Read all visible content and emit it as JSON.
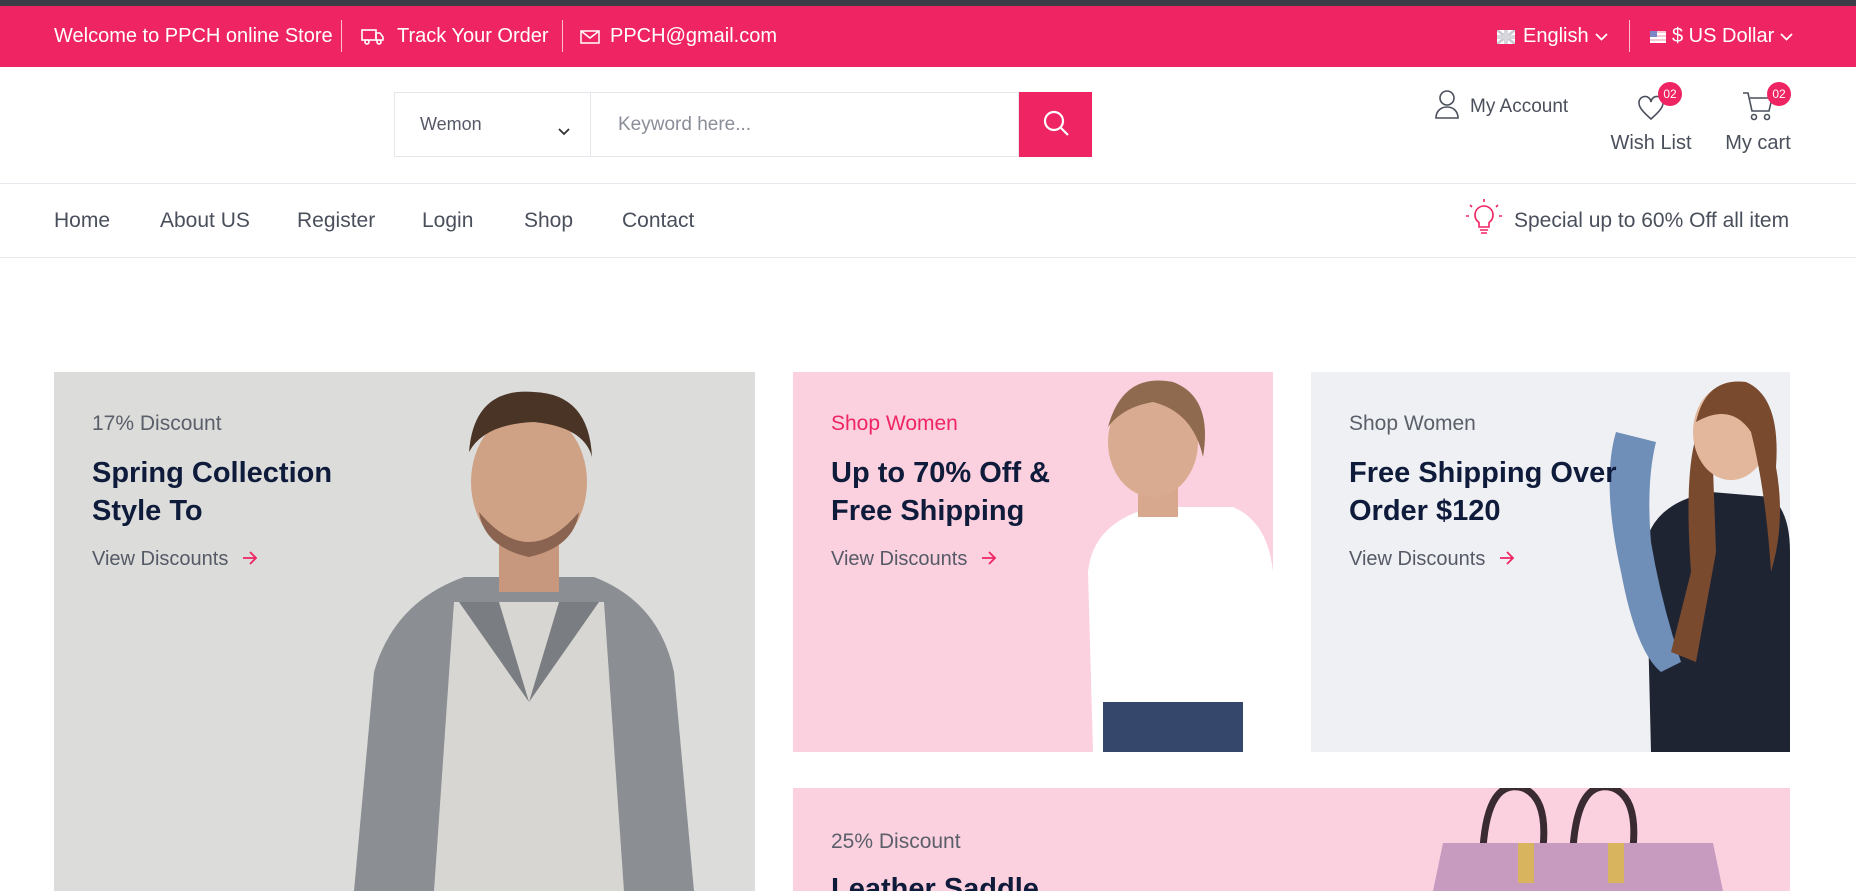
{
  "topbar": {
    "welcome": "Welcome to PPCH online Store",
    "track_order": "Track Your Order",
    "email": "PPCH@gmail.com",
    "language": "English",
    "currency": "$ US Dollar",
    "icons": [
      "truck-icon",
      "mail-icon",
      "uk-flag-icon",
      "us-flag-icon",
      "chevron-down-icon"
    ]
  },
  "header": {
    "category_selected": "Wemon",
    "search_placeholder": "Keyword here...",
    "account_label": "My Account",
    "wishlist_label": "Wish List",
    "wishlist_count": "02",
    "cart_label": "My cart",
    "cart_count": "02",
    "icons": [
      "search-icon",
      "user-icon",
      "heart-icon",
      "cart-icon"
    ]
  },
  "nav": {
    "items": [
      "Home",
      "About US",
      "Register",
      "Login",
      "Shop",
      "Contact"
    ],
    "promo_text": "Special up to 60% Off all item",
    "promo_icon": "lightbulb-icon"
  },
  "banners": [
    {
      "eyebrow": "17% Discount",
      "title_line1": "Spring Collection",
      "title_line2": "Style To",
      "cta": "View Discounts"
    },
    {
      "eyebrow": "Shop Women",
      "title_line1": "Up to 70% Off &",
      "title_line2": "Free Shipping",
      "cta": "View Discounts"
    },
    {
      "eyebrow": "Shop Women",
      "title_line1": "Free Shipping Over",
      "title_line2": "Order $120",
      "cta": "View Discounts"
    },
    {
      "eyebrow": "25% Discount",
      "title_line1": "Leather Saddle"
    }
  ],
  "colors": {
    "brand": "#ef2463",
    "heading": "#0f1b3a",
    "banner_gray": "#dcdcdb",
    "banner_pink": "#fcd1df",
    "banner_light": "#eff0f4"
  }
}
